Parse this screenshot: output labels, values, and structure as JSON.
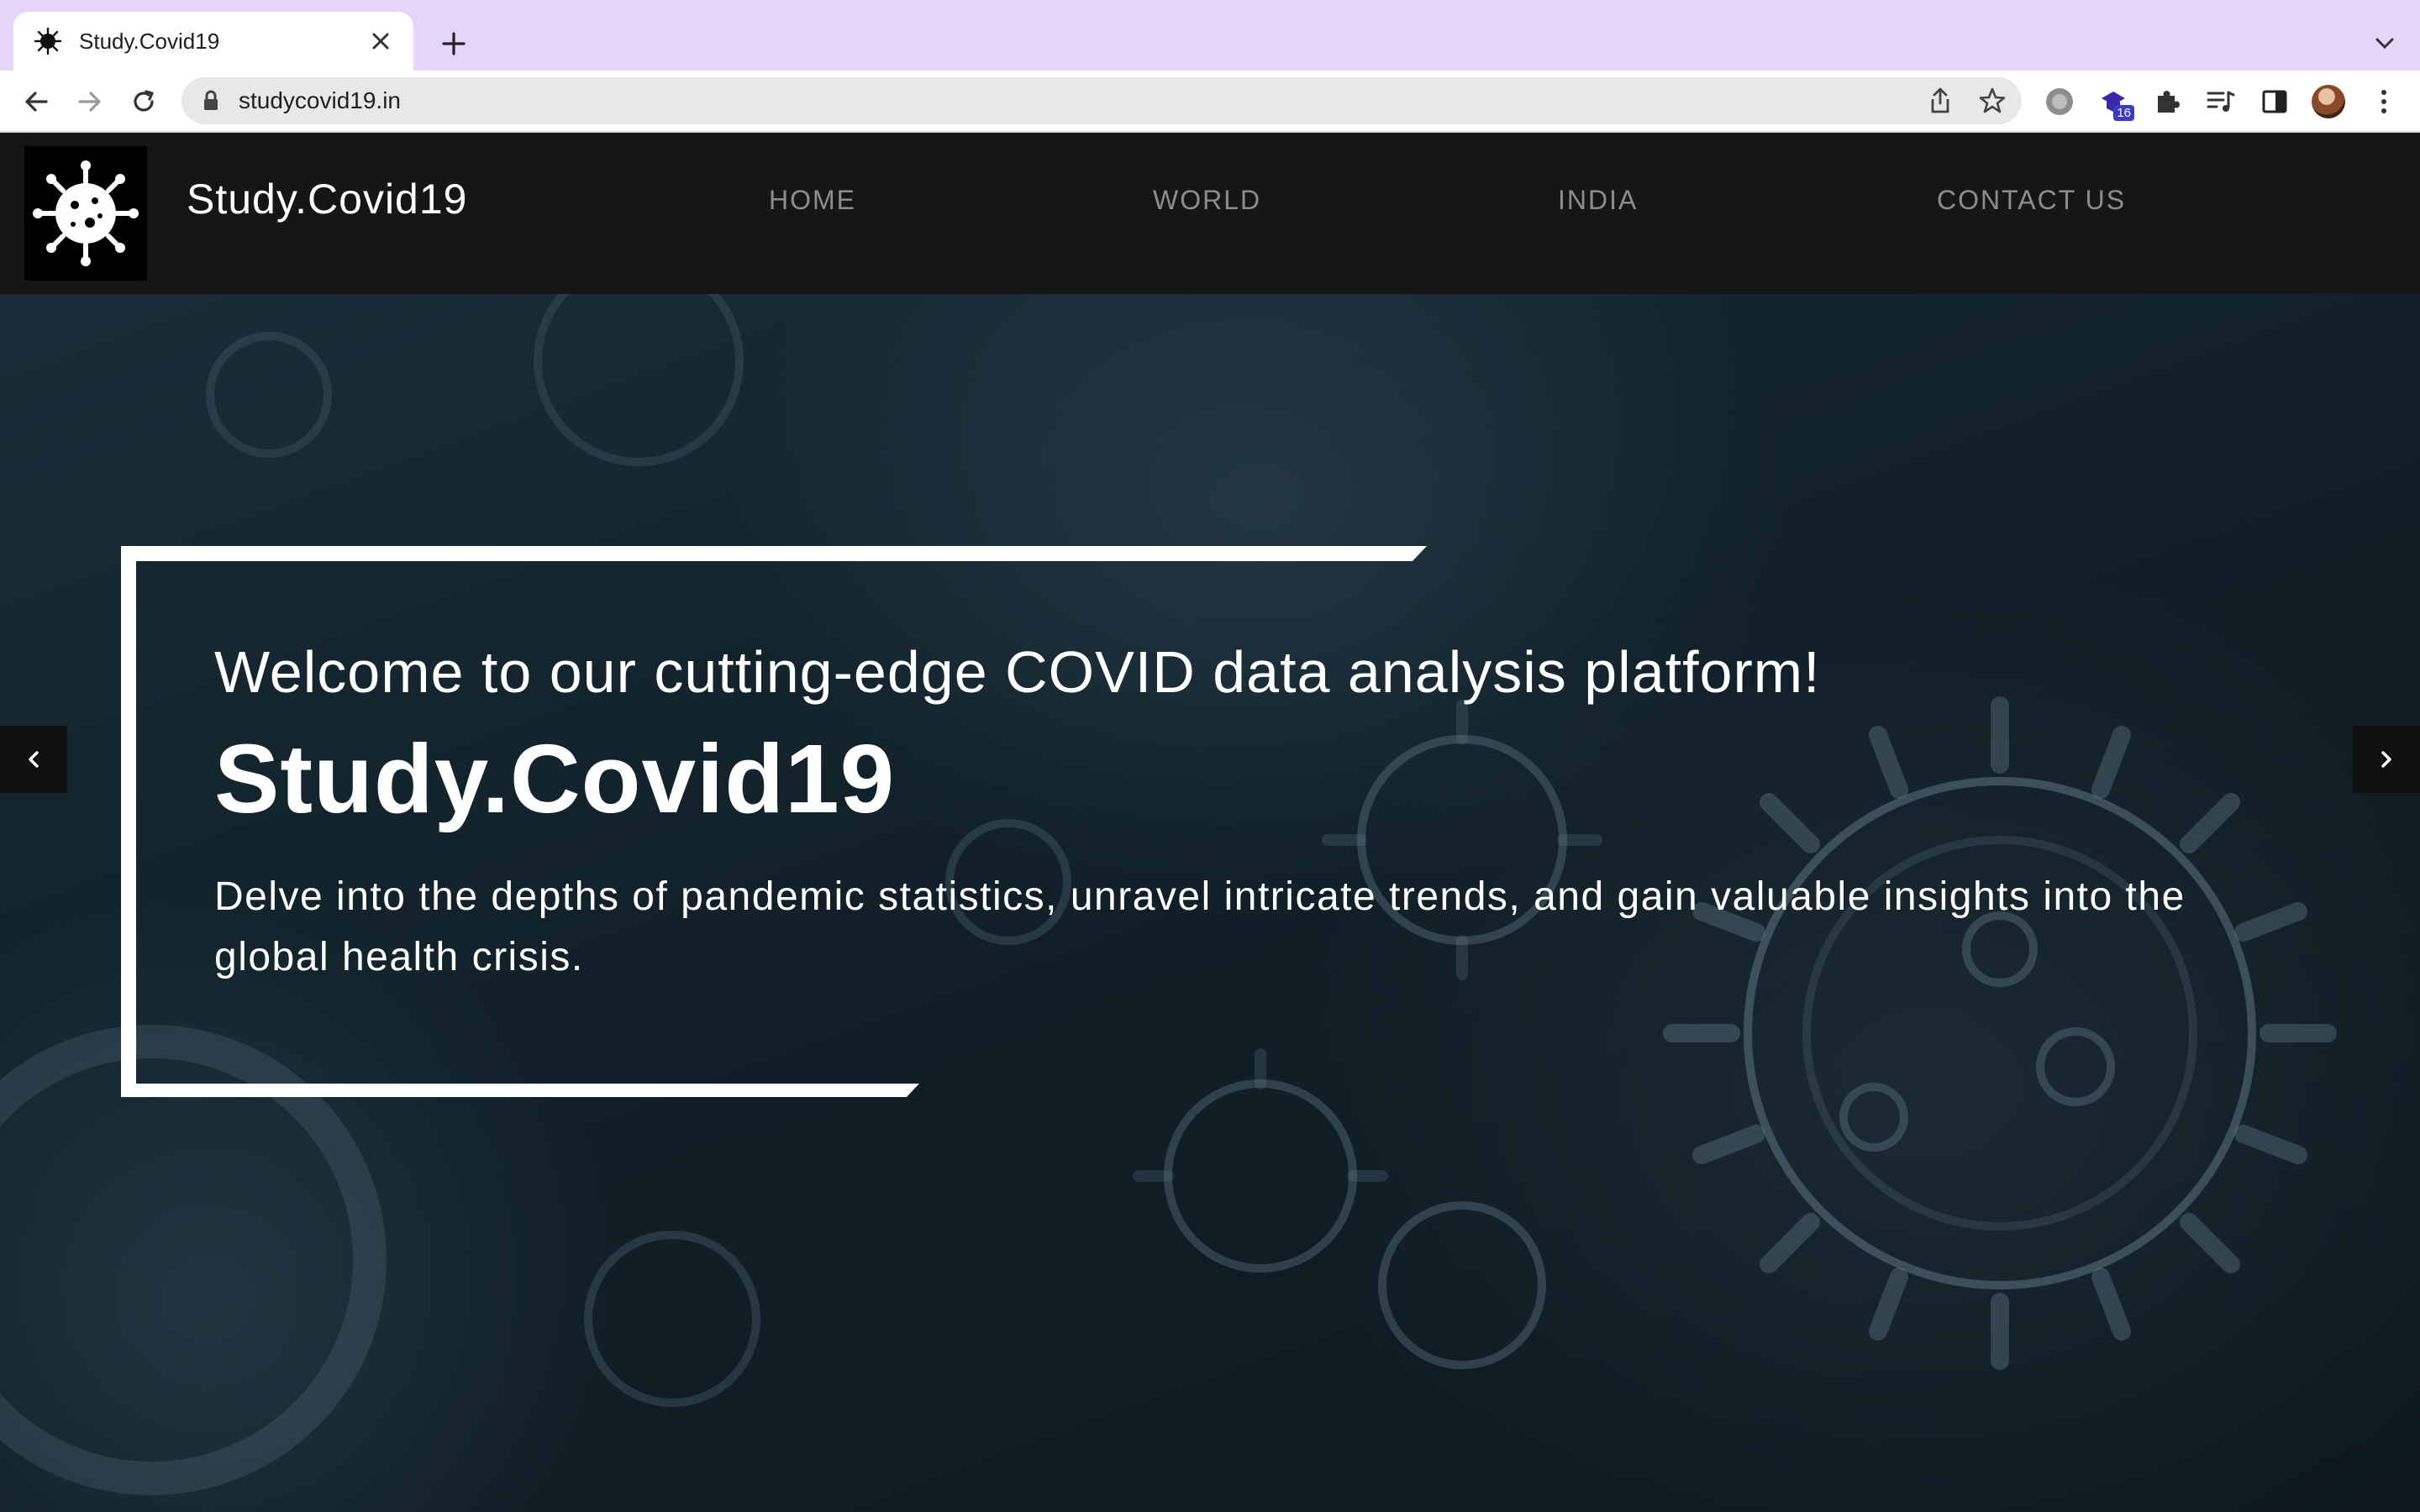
{
  "browser": {
    "tab_title": "Study.Covid19",
    "url": "studycovid19.in",
    "extension_badge": "16"
  },
  "site": {
    "brand": "Study.Covid19",
    "nav": [
      "HOME",
      "WORLD",
      "INDIA",
      "CONTACT US"
    ]
  },
  "hero": {
    "welcome": "Welcome to our cutting-edge COVID data analysis platform!",
    "title": "Study.Covid19",
    "description": "Delve into the depths of pandemic statistics, unravel intricate trends, and gain valuable insights into the global health crisis."
  },
  "colors": {
    "tabstrip": "#e6d5fb",
    "navbar": "#151618",
    "nav_link": "#8d8d8f",
    "hero_bg": "#112028",
    "text": "#ffffff"
  },
  "icons": {
    "favicon": "virus-icon",
    "close": "close-icon",
    "new_tab": "plus-icon",
    "back": "arrow-left-icon",
    "forward": "arrow-right-icon",
    "reload": "reload-icon",
    "lock": "lock-icon",
    "share": "share-icon",
    "bookmark": "star-icon",
    "carousel_prev": "chevron-left-icon",
    "carousel_next": "chevron-right-icon"
  }
}
